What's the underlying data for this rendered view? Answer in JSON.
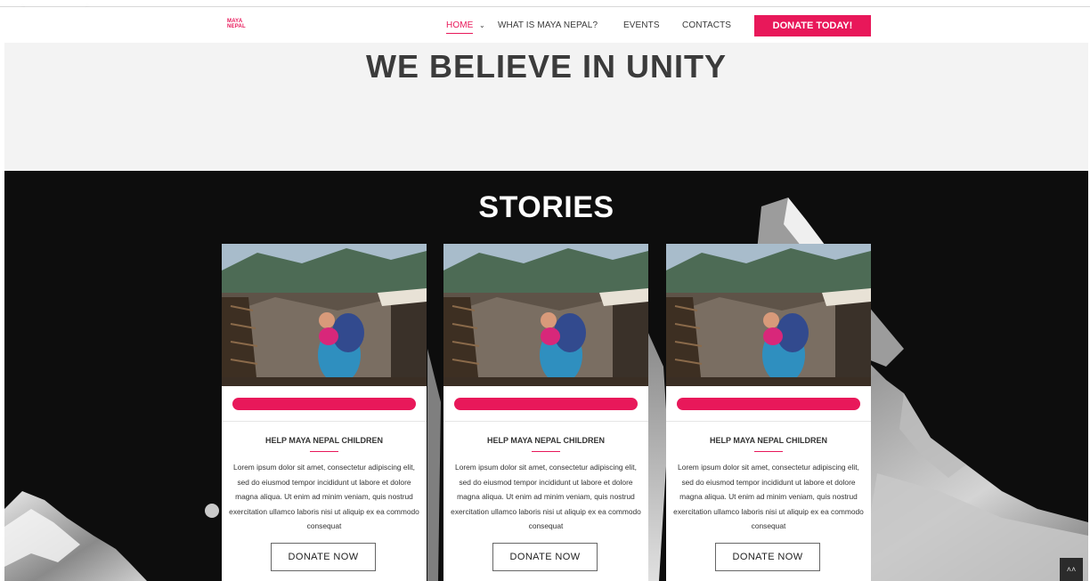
{
  "nav": {
    "logo_line1": "MAYA",
    "logo_line2": "NEPAL",
    "items": [
      {
        "label": "HOME"
      },
      {
        "label": "WHAT IS MAYA NEPAL?"
      },
      {
        "label": "EVENTS"
      },
      {
        "label": "CONTACTS"
      }
    ],
    "donate_label": "DONATE TODAY!"
  },
  "hero": {
    "title": "WE BELIEVE IN UNITY"
  },
  "stories": {
    "title": "STORIES",
    "cards": [
      {
        "title": "HELP MAYA NEPAL CHILDREN",
        "text": "Lorem ipsum dolor sit amet, consectetur adipiscing elit, sed do eiusmod tempor incididunt ut labore et dolore magna aliqua. Ut enim ad minim veniam, quis nostrud exercitation ullamco laboris nisi ut aliquip ex ea commodo consequat",
        "button": "DONATE NOW"
      },
      {
        "title": "HELP MAYA NEPAL CHILDREN",
        "text": "Lorem ipsum dolor sit amet, consectetur adipiscing elit, sed do eiusmod tempor incididunt ut labore et dolore magna aliqua. Ut enim ad minim veniam, quis nostrud exercitation ullamco laboris nisi ut aliquip ex ea commodo consequat",
        "button": "DONATE NOW"
      },
      {
        "title": "HELP MAYA NEPAL CHILDREN",
        "text": "Lorem ipsum dolor sit amet, consectetur adipiscing elit, sed do eiusmod tempor incididunt ut labore et dolore magna aliqua. Ut enim ad minim veniam, quis nostrud exercitation ullamco laboris nisi ut aliquip ex ea commodo consequat",
        "button": "DONATE NOW"
      }
    ]
  },
  "colors": {
    "accent": "#e8185a",
    "hero_bg": "#f3f3f3",
    "stories_bg": "#0c0c0c",
    "text_dark": "#3b3b3b"
  },
  "icons": {
    "nav_dropdown": "chevron-down-icon",
    "scroll_top": "double-chevron-up-icon"
  }
}
